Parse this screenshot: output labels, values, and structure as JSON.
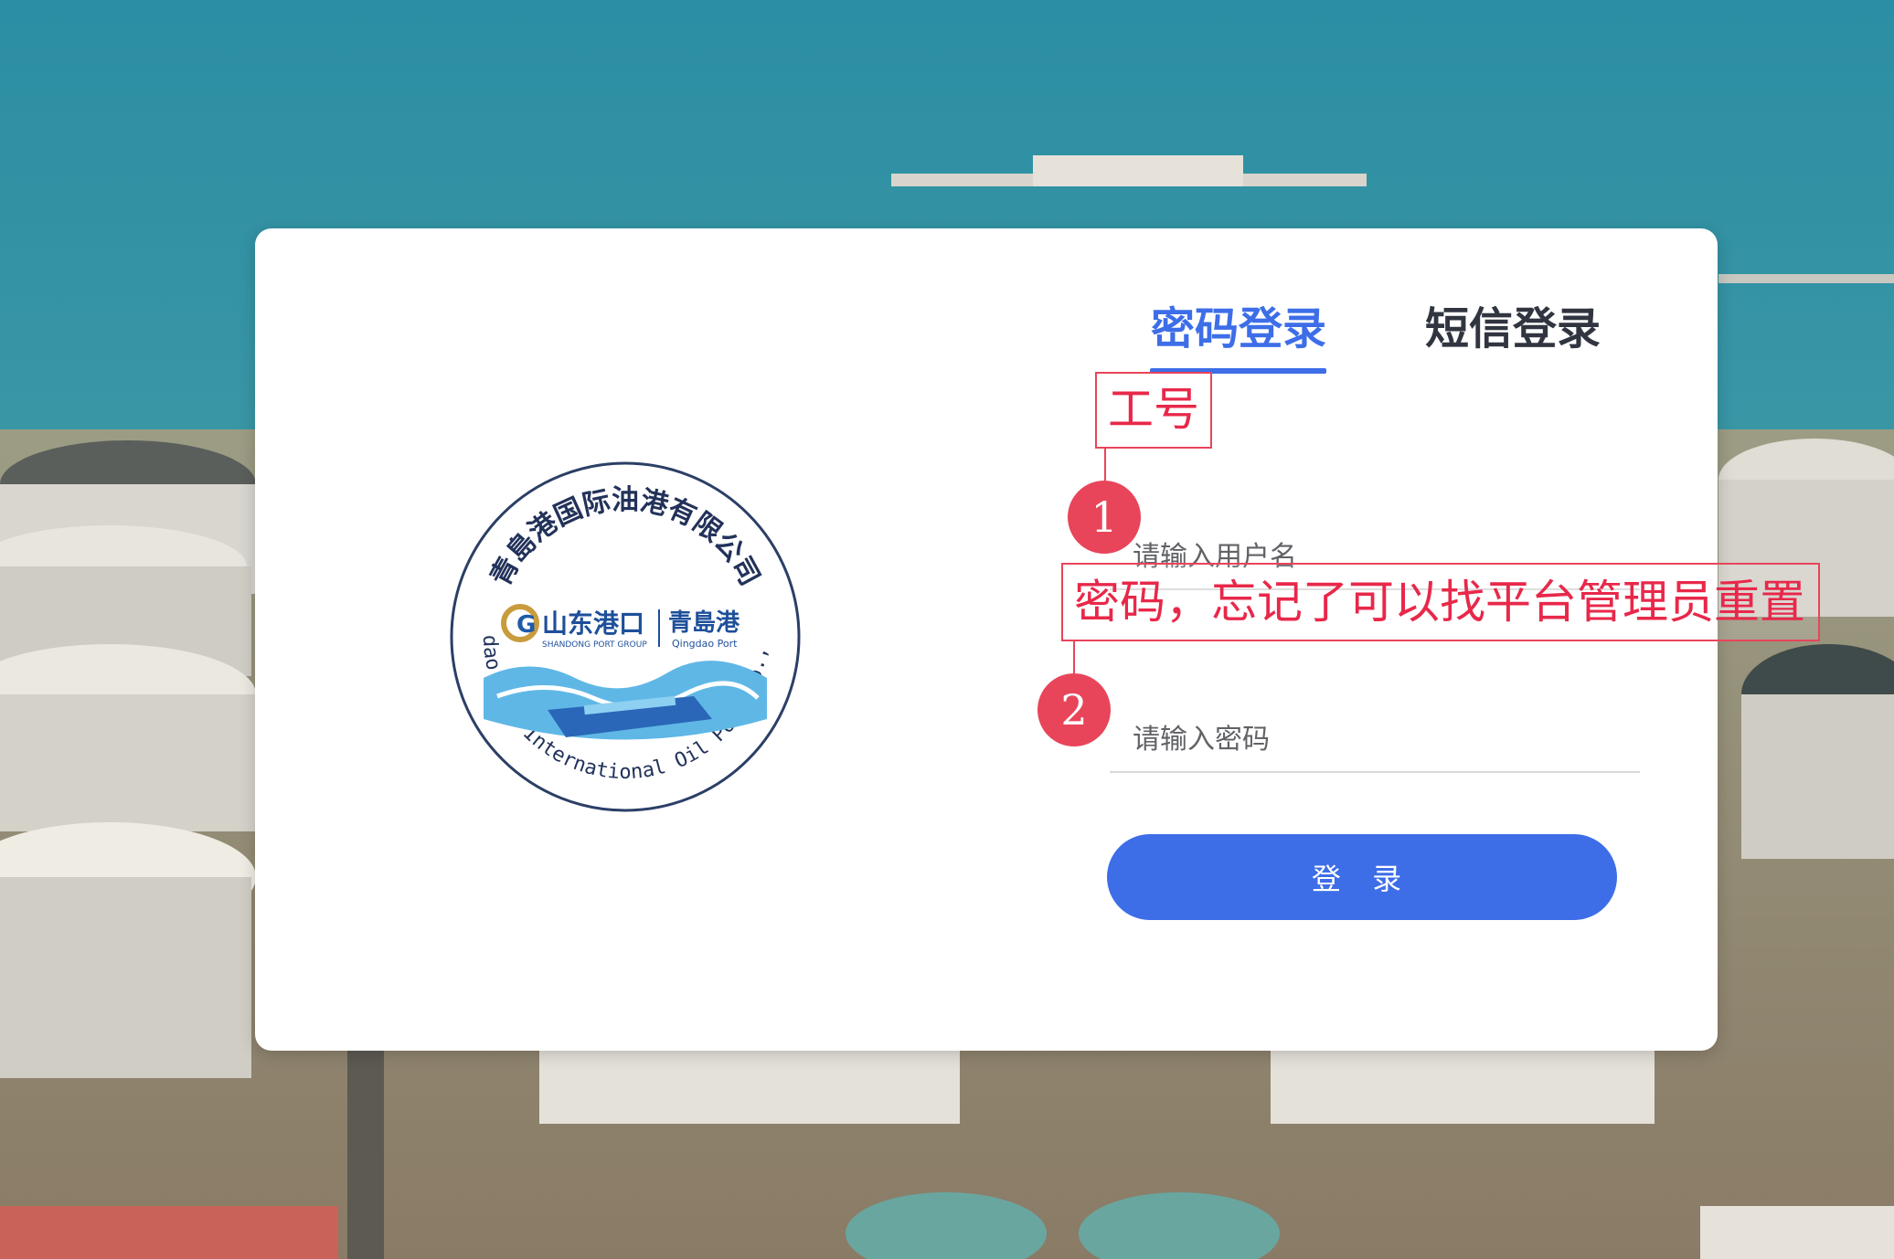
{
  "tabs": {
    "password_login": "密码登录",
    "sms_login": "短信登录"
  },
  "form": {
    "username_placeholder": "请输入用户名",
    "password_placeholder": "请输入密码",
    "login_button": "登 录"
  },
  "logo": {
    "arc_text_cn": "青島港国际油港有限公司",
    "arc_text_en": "Qingdao Port International Oil Port Co., Ltd.",
    "brand_cn": "山东港口",
    "brand_en": "SHANDONG PORT GROUP",
    "sub_cn": "青島港",
    "sub_en": "Qingdao Port"
  },
  "annotations": {
    "label_1": "工号",
    "label_2": "密码，忘记了可以找平台管理员重置",
    "badge_1": "1",
    "badge_2": "2"
  },
  "colors": {
    "accent": "#3d6ee8",
    "annotation": "#e8455a"
  }
}
